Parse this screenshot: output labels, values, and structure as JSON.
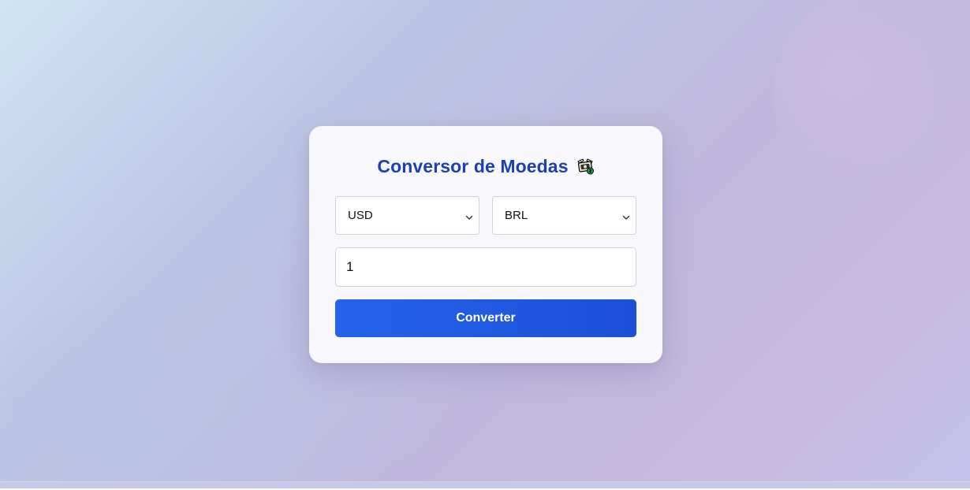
{
  "app": {
    "title": "Conversor de Moedas",
    "title_icon": "money-with-wings-icon",
    "accent_color": "#1e40af",
    "button_color": "#2563eb"
  },
  "form": {
    "from_currency": {
      "selected": "USD",
      "icon": "chevron-down-icon"
    },
    "to_currency": {
      "selected": "BRL",
      "icon": "chevron-down-icon"
    },
    "amount": {
      "value": "1"
    },
    "convert_button": {
      "label": "Converter"
    }
  }
}
